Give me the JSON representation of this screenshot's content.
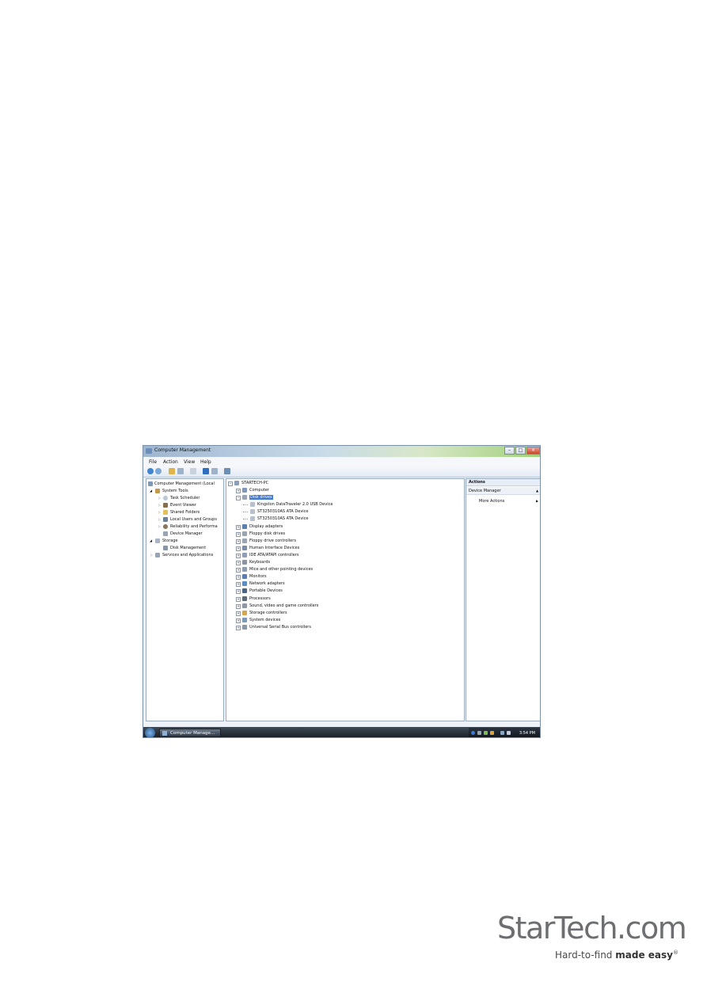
{
  "window": {
    "title": "Computer Management",
    "menu": [
      "File",
      "Action",
      "View",
      "Help"
    ]
  },
  "left_tree": [
    {
      "label": "Computer Management (Local",
      "level": 0
    },
    {
      "label": "System Tools",
      "level": 1
    },
    {
      "label": "Task Scheduler",
      "level": 2
    },
    {
      "label": "Event Viewer",
      "level": 2
    },
    {
      "label": "Shared Folders",
      "level": 2
    },
    {
      "label": "Local Users and Groups",
      "level": 2
    },
    {
      "label": "Reliability and Performa",
      "level": 2
    },
    {
      "label": "Device Manager",
      "level": 2
    },
    {
      "label": "Storage",
      "level": 1
    },
    {
      "label": "Disk Management",
      "level": 2
    },
    {
      "label": "Services and Applications",
      "level": 1
    }
  ],
  "device_tree": {
    "root": "STARTECH-PC",
    "items": [
      {
        "label": "Computer",
        "level": 1
      },
      {
        "label": "Disk drives",
        "level": 1,
        "selected": true
      },
      {
        "label": "Kingston DataTraveler 2.0 USB Device",
        "level": 2
      },
      {
        "label": "ST3250310AS ATA Device",
        "level": 2
      },
      {
        "label": "ST3250310AS ATA Device",
        "level": 2
      },
      {
        "label": "Display adapters",
        "level": 1
      },
      {
        "label": "Floppy disk drives",
        "level": 1
      },
      {
        "label": "Floppy drive controllers",
        "level": 1
      },
      {
        "label": "Human Interface Devices",
        "level": 1
      },
      {
        "label": "IDE ATA/ATAPI controllers",
        "level": 1
      },
      {
        "label": "Keyboards",
        "level": 1
      },
      {
        "label": "Mice and other pointing devices",
        "level": 1
      },
      {
        "label": "Monitors",
        "level": 1
      },
      {
        "label": "Network adapters",
        "level": 1
      },
      {
        "label": "Portable Devices",
        "level": 1
      },
      {
        "label": "Processors",
        "level": 1
      },
      {
        "label": "Sound, video and game controllers",
        "level": 1
      },
      {
        "label": "Storage controllers",
        "level": 1
      },
      {
        "label": "System devices",
        "level": 1
      },
      {
        "label": "Universal Serial Bus controllers",
        "level": 1
      }
    ]
  },
  "actions": {
    "header": "Actions",
    "section": "Device Manager",
    "more": "More Actions"
  },
  "taskbar": {
    "button": "Computer Manage...",
    "clock": "3:54 PM"
  },
  "logo": {
    "brand": "StarTech.com",
    "tagline_plain": "Hard-to-find ",
    "tagline_bold": "made easy",
    "trademark": "®"
  }
}
